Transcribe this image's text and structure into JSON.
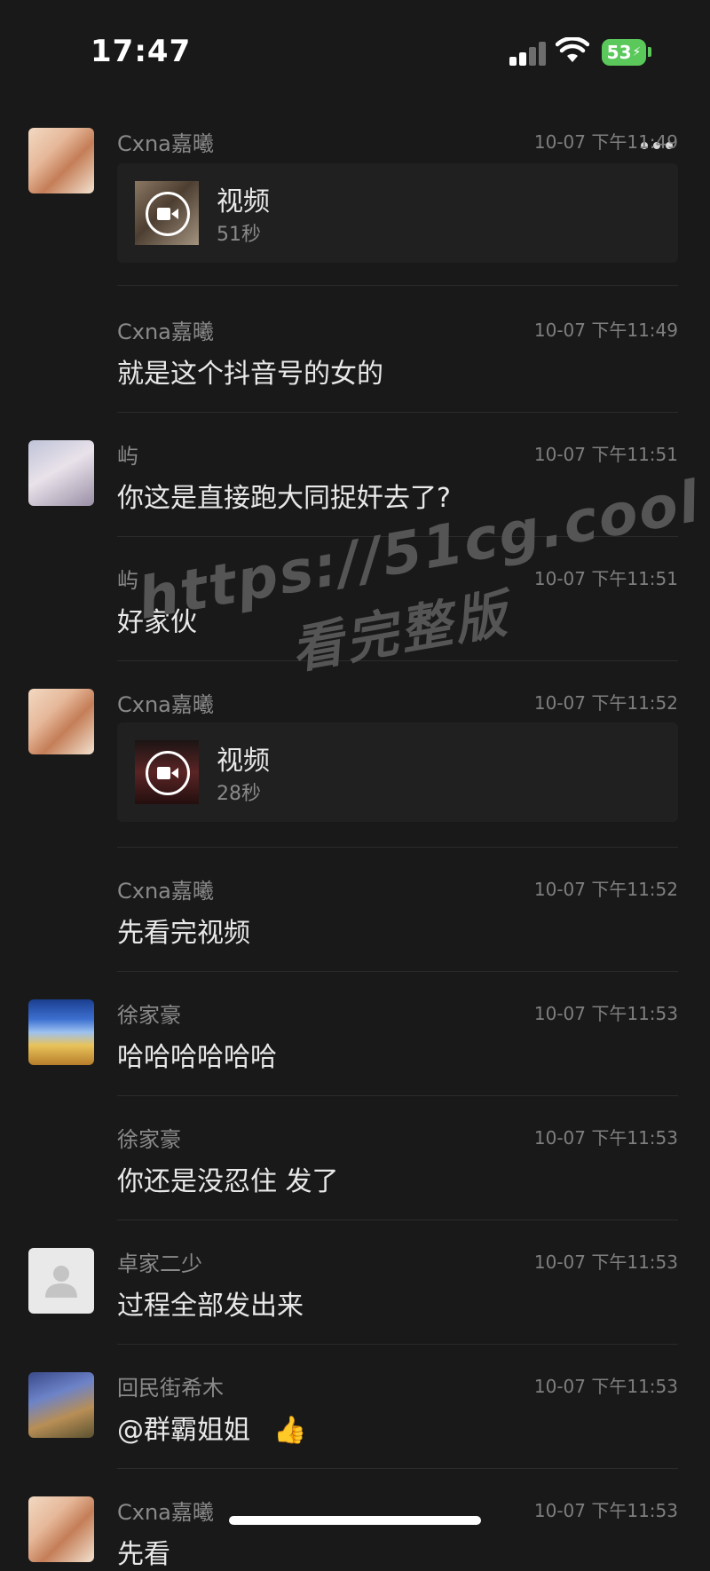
{
  "status_bar": {
    "time": "17:47",
    "battery": "53"
  },
  "messages": [
    {
      "sender": "Cxna嘉曦",
      "time": "10-07 下午11:49",
      "type": "video",
      "title": "视频",
      "duration": "51秒"
    },
    {
      "sender": "Cxna嘉曦",
      "time": "10-07 下午11:49",
      "text": "就是这个抖音号的女的"
    },
    {
      "sender": "屿",
      "time": "10-07 下午11:51",
      "text": "你这是直接跑大同捉奸去了?"
    },
    {
      "sender": "屿",
      "time": "10-07 下午11:51",
      "text": "好家伙"
    },
    {
      "sender": "Cxna嘉曦",
      "time": "10-07 下午11:52",
      "type": "video",
      "title": "视频",
      "duration": "28秒"
    },
    {
      "sender": "Cxna嘉曦",
      "time": "10-07 下午11:52",
      "text": "先看完视频"
    },
    {
      "sender": "徐家豪",
      "time": "10-07 下午11:53",
      "text": "哈哈哈哈哈哈"
    },
    {
      "sender": "徐家豪",
      "time": "10-07 下午11:53",
      "text": "你还是没忍住 发了"
    },
    {
      "sender": "卓家二少",
      "time": "10-07 下午11:53",
      "text": "过程全部发出来"
    },
    {
      "sender": "回民街希木",
      "time": "10-07 下午11:53",
      "text": "@群霸姐姐",
      "emoji": "👍"
    },
    {
      "sender": "Cxna嘉曦",
      "time": "10-07 下午11:53",
      "text": "先看"
    }
  ],
  "watermark": {
    "url": "https://51cg.cool",
    "subtitle": "看完整版"
  }
}
